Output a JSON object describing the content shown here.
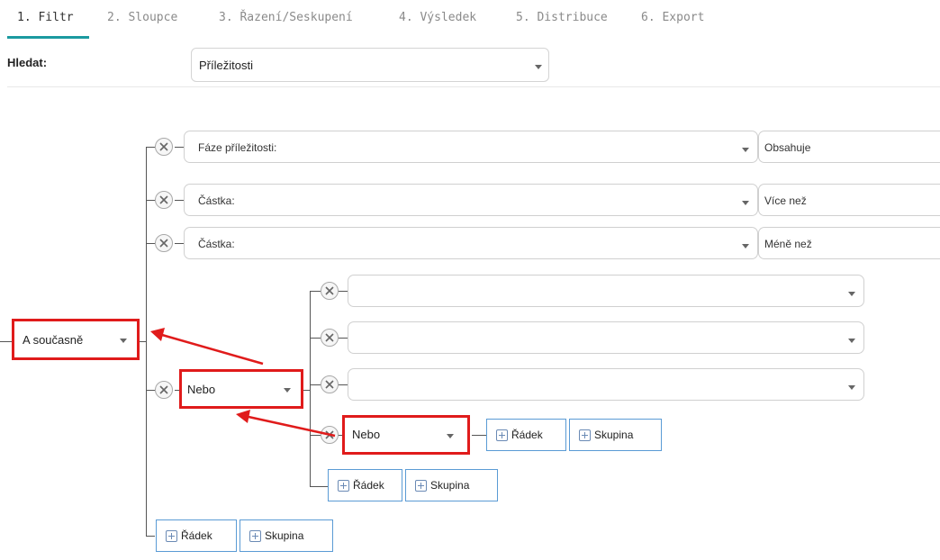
{
  "tabs": [
    {
      "label": "1. Filtr",
      "active": true
    },
    {
      "label": "2. Sloupce"
    },
    {
      "label": "3. Řazení/Seskupení"
    },
    {
      "label": "4. Výsledek"
    },
    {
      "label": "5. Distribuce"
    },
    {
      "label": "6. Export"
    }
  ],
  "search": {
    "label": "Hledat:",
    "value": "Příležitosti"
  },
  "root_group": {
    "operator": "A současně"
  },
  "conditions": [
    {
      "field": "Fáze příležitosti:",
      "operator": "Obsahuje"
    },
    {
      "field": "Částka:",
      "operator": "Více než"
    },
    {
      "field": "Částka:",
      "operator": "Méně než"
    }
  ],
  "or_group": {
    "operator": "Nebo"
  },
  "nested_or_group": {
    "operator": "Nebo"
  },
  "buttons": {
    "row": "Řádek",
    "group": "Skupina"
  },
  "colors": {
    "accent": "#1b9aa0",
    "highlight": "#e01b1b",
    "button_border": "#5a9bd5"
  },
  "icons": {
    "remove": "remove-circle-x-icon",
    "add": "plus-square-icon",
    "dropdown": "caret-down-icon"
  }
}
